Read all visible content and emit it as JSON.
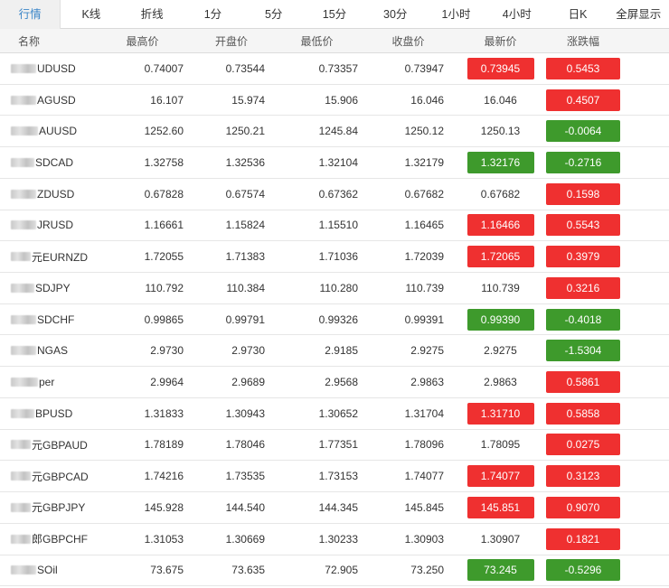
{
  "tabs": [
    "行情",
    "K线",
    "折线",
    "1分",
    "5分",
    "15分",
    "30分",
    "1小时",
    "4小时",
    "日K",
    "全屏显示"
  ],
  "active_tab": 0,
  "headers": {
    "name": "名称",
    "high": "最高价",
    "open": "开盘价",
    "low": "最低价",
    "close": "收盘价",
    "last": "最新价",
    "change": "涨跌幅"
  },
  "colors": {
    "up": "#ef3030",
    "down": "#3e9a2c",
    "accent": "#3b86c8"
  },
  "rows": [
    {
      "name": "UDUSD",
      "high": "0.74007",
      "open": "0.73544",
      "low": "0.73357",
      "close": "0.73947",
      "last": "0.73945",
      "last_state": "up",
      "change": "0.5453",
      "change_state": "up"
    },
    {
      "name": "AGUSD",
      "high": "16.107",
      "open": "15.974",
      "low": "15.906",
      "close": "16.046",
      "last": "16.046",
      "last_state": "flat",
      "change": "0.4507",
      "change_state": "up"
    },
    {
      "name": "AUUSD",
      "high": "1252.60",
      "open": "1250.21",
      "low": "1245.84",
      "close": "1250.12",
      "last": "1250.13",
      "last_state": "flat",
      "change": "-0.0064",
      "change_state": "down"
    },
    {
      "name": "SDCAD",
      "high": "1.32758",
      "open": "1.32536",
      "low": "1.32104",
      "close": "1.32179",
      "last": "1.32176",
      "last_state": "down",
      "change": "-0.2716",
      "change_state": "down"
    },
    {
      "name": "ZDUSD",
      "high": "0.67828",
      "open": "0.67574",
      "low": "0.67362",
      "close": "0.67682",
      "last": "0.67682",
      "last_state": "flat",
      "change": "0.1598",
      "change_state": "up"
    },
    {
      "name": "JRUSD",
      "high": "1.16661",
      "open": "1.15824",
      "low": "1.15510",
      "close": "1.16465",
      "last": "1.16466",
      "last_state": "up",
      "change": "0.5543",
      "change_state": "up"
    },
    {
      "name": "元EURNZD",
      "high": "1.72055",
      "open": "1.71383",
      "low": "1.71036",
      "close": "1.72039",
      "last": "1.72065",
      "last_state": "up",
      "change": "0.3979",
      "change_state": "up"
    },
    {
      "name": "SDJPY",
      "high": "110.792",
      "open": "110.384",
      "low": "110.280",
      "close": "110.739",
      "last": "110.739",
      "last_state": "flat",
      "change": "0.3216",
      "change_state": "up"
    },
    {
      "name": "SDCHF",
      "high": "0.99865",
      "open": "0.99791",
      "low": "0.99326",
      "close": "0.99391",
      "last": "0.99390",
      "last_state": "down",
      "change": "-0.4018",
      "change_state": "down"
    },
    {
      "name": "NGAS",
      "high": "2.9730",
      "open": "2.9730",
      "low": "2.9185",
      "close": "2.9275",
      "last": "2.9275",
      "last_state": "flat",
      "change": "-1.5304",
      "change_state": "down"
    },
    {
      "name": "per",
      "high": "2.9964",
      "open": "2.9689",
      "low": "2.9568",
      "close": "2.9863",
      "last": "2.9863",
      "last_state": "flat",
      "change": "0.5861",
      "change_state": "up"
    },
    {
      "name": "BPUSD",
      "high": "1.31833",
      "open": "1.30943",
      "low": "1.30652",
      "close": "1.31704",
      "last": "1.31710",
      "last_state": "up",
      "change": "0.5858",
      "change_state": "up"
    },
    {
      "name": "元GBPAUD",
      "high": "1.78189",
      "open": "1.78046",
      "low": "1.77351",
      "close": "1.78096",
      "last": "1.78095",
      "last_state": "flat",
      "change": "0.0275",
      "change_state": "up"
    },
    {
      "name": "元GBPCAD",
      "high": "1.74216",
      "open": "1.73535",
      "low": "1.73153",
      "close": "1.74077",
      "last": "1.74077",
      "last_state": "up",
      "change": "0.3123",
      "change_state": "up"
    },
    {
      "name": "元GBPJPY",
      "high": "145.928",
      "open": "144.540",
      "low": "144.345",
      "close": "145.845",
      "last": "145.851",
      "last_state": "up",
      "change": "0.9070",
      "change_state": "up"
    },
    {
      "name": "郎GBPCHF",
      "high": "1.31053",
      "open": "1.30669",
      "low": "1.30233",
      "close": "1.30903",
      "last": "1.30907",
      "last_state": "flat",
      "change": "0.1821",
      "change_state": "up"
    },
    {
      "name": "SOil",
      "high": "73.675",
      "open": "73.635",
      "low": "72.905",
      "close": "73.250",
      "last": "73.245",
      "last_state": "down",
      "change": "-0.5296",
      "change_state": "down"
    }
  ]
}
